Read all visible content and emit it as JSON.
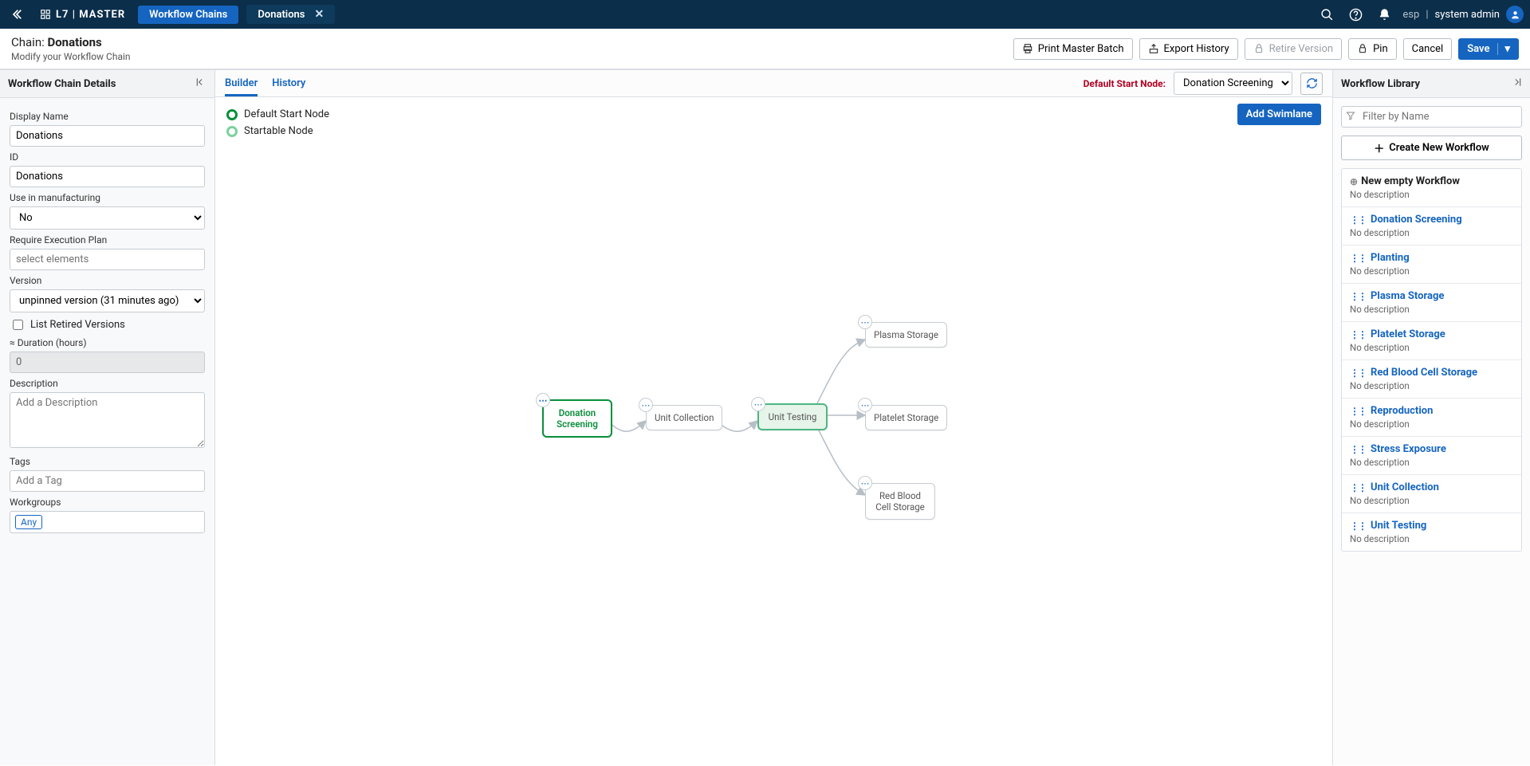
{
  "topbar": {
    "brand": "L7 | MASTER",
    "tab_primary": "Workflow Chains",
    "tab_secondary": "Donations",
    "lang": "esp",
    "sep": "|",
    "user": "system admin"
  },
  "subheader": {
    "title_prefix": "Chain: ",
    "title_name": "Donations",
    "subtitle": "Modify your Workflow Chain",
    "actions": {
      "print": "Print Master Batch",
      "export": "Export History",
      "retire": "Retire Version",
      "pin": "Pin",
      "cancel": "Cancel",
      "save": "Save"
    }
  },
  "left": {
    "panel_title": "Workflow Chain Details",
    "display_name_label": "Display Name",
    "display_name_value": "Donations",
    "id_label": "ID",
    "id_value": "Donations",
    "use_label": "Use in manufacturing",
    "use_value": "No",
    "exec_label": "Require Execution Plan",
    "exec_placeholder": "select elements",
    "version_label": "Version",
    "version_value": "unpinned version (31 minutes ago)",
    "retired_checkbox": "List Retired Versions",
    "duration_label": "≈ Duration (hours)",
    "duration_value": "0",
    "description_label": "Description",
    "description_placeholder": "Add a Description",
    "tags_label": "Tags",
    "tags_placeholder": "Add a Tag",
    "workgroups_label": "Workgroups",
    "workgroups_value": "Any"
  },
  "center": {
    "tab_builder": "Builder",
    "tab_history": "History",
    "dsn_label": "Default Start Node:",
    "dsn_value": "Donation Screening",
    "legend_default": "Default Start Node",
    "legend_startable": "Startable Node",
    "add_swimlane": "Add Swimlane",
    "nodes": {
      "n1": "Donation Screening",
      "n2": "Unit Collection",
      "n3": "Unit Testing",
      "n4": "Plasma Storage",
      "n5": "Platelet Storage",
      "n6": "Red Blood Cell Storage"
    }
  },
  "right": {
    "panel_title": "Workflow Library",
    "filter_placeholder": "Filter by Name",
    "create_label": "Create New Workflow",
    "no_desc": "No description",
    "items": [
      {
        "name": "New empty Workflow",
        "link": false,
        "icon": "plus"
      },
      {
        "name": "Donation Screening",
        "link": true,
        "icon": "dots"
      },
      {
        "name": "Planting",
        "link": true,
        "icon": "dots"
      },
      {
        "name": "Plasma Storage",
        "link": true,
        "icon": "dots"
      },
      {
        "name": "Platelet Storage",
        "link": true,
        "icon": "dots"
      },
      {
        "name": "Red Blood Cell Storage",
        "link": true,
        "icon": "dots"
      },
      {
        "name": "Reproduction",
        "link": true,
        "icon": "dots"
      },
      {
        "name": "Stress Exposure",
        "link": true,
        "icon": "dots"
      },
      {
        "name": "Unit Collection",
        "link": true,
        "icon": "dots"
      },
      {
        "name": "Unit Testing",
        "link": true,
        "icon": "dots"
      }
    ]
  }
}
